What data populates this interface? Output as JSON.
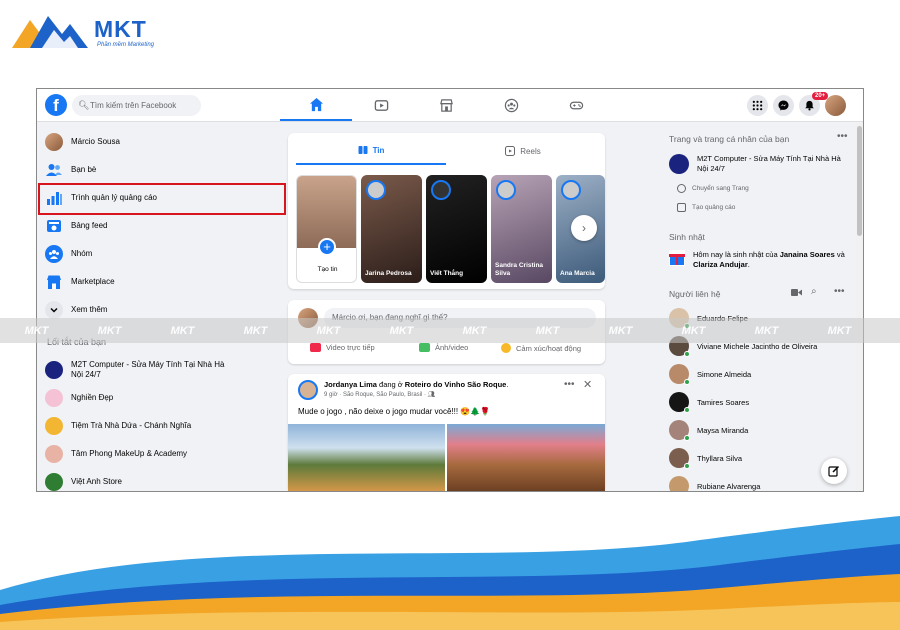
{
  "brand": {
    "name": "MKT",
    "tagline": "Phần mềm Marketing",
    "colors": {
      "primary": "#1c62c9",
      "accent": "#f3a526",
      "highlight": "#d8141d"
    }
  },
  "topbar": {
    "search_placeholder": "Tìm kiếm trên Facebook",
    "badge_count": "20+",
    "nav_tabs": [
      "home-icon",
      "watch-icon",
      "marketplace-icon",
      "groups-icon",
      "gaming-icon"
    ]
  },
  "left_sidebar": {
    "items": [
      {
        "label": "Márcio Sousa",
        "icon": "profile-avatar"
      },
      {
        "label": "Bạn bè",
        "icon": "friends-icon"
      },
      {
        "label": "Trình quản lý quảng cáo",
        "icon": "ads-manager-icon"
      },
      {
        "label": "Bảng feed",
        "icon": "feed-icon"
      },
      {
        "label": "Nhóm",
        "icon": "groups-icon"
      },
      {
        "label": "Marketplace",
        "icon": "marketplace-icon"
      },
      {
        "label": "Xem thêm",
        "icon": "chevron-down-icon"
      }
    ],
    "shortcuts_title": "Lối tắt của bạn",
    "shortcuts": [
      {
        "label": "M2T Computer - Sửa Máy Tính Tại Nhà Hà Nội 24/7"
      },
      {
        "label": "Nghiền Đẹp"
      },
      {
        "label": "Tiệm Trà Nhà Dứa - Chánh Nghĩa"
      },
      {
        "label": "Tâm Phong MakeUp & Academy"
      },
      {
        "label": "Việt Anh Store"
      }
    ]
  },
  "stories": {
    "tab_stories": "Tin",
    "tab_reels": "Reels",
    "create_label": "Tạo tin",
    "items": [
      {
        "name": "Jarina Pedrosa"
      },
      {
        "name": "Viết Thắng"
      },
      {
        "name": "Sandra Cristina Silva"
      },
      {
        "name": "Ana Marcia"
      }
    ]
  },
  "composer": {
    "placeholder": "Márcio ơi, bạn đang nghĩ gì thế?",
    "actions": [
      "Video trực tiếp",
      "Ảnh/video",
      "Cảm xúc/hoạt động"
    ]
  },
  "post": {
    "author": "Jordanya Lima",
    "mid": " đang ở ",
    "place": "Roteiro do Vinho São Roque",
    "meta": "9 giờ · São Roque, São Paulo, Brasil · ",
    "text": "Mude o jogo , não  deixe o jogo mudar você!!! 😍🌲🌹"
  },
  "right_sidebar": {
    "pages_title": "Trang và trang cá nhân của bạn",
    "page_name": "M2T Computer - Sửa Máy Tính Tại Nhà Hà Nội 24/7",
    "switch_page": "Chuyển sang Trang",
    "create_ad": "Tạo quảng cáo",
    "birthday_title": "Sinh nhật",
    "birthday_pre": "Hôm nay là sinh nhật của ",
    "birthday_name1": "Janaina Soares",
    "birthday_mid": " và ",
    "birthday_name2": "Clariza Andujar",
    "birthday_end": ".",
    "contacts_title": "Người liên hệ",
    "contacts": [
      "Eduardo Felipe",
      "Viviane Michele Jacintho de Oliveira",
      "Simone Almeida",
      "Tamires Soares",
      "Maysa Miranda",
      "Thyllara Silva",
      "Rubiane Alvarenga"
    ]
  },
  "watermark": "MKT"
}
